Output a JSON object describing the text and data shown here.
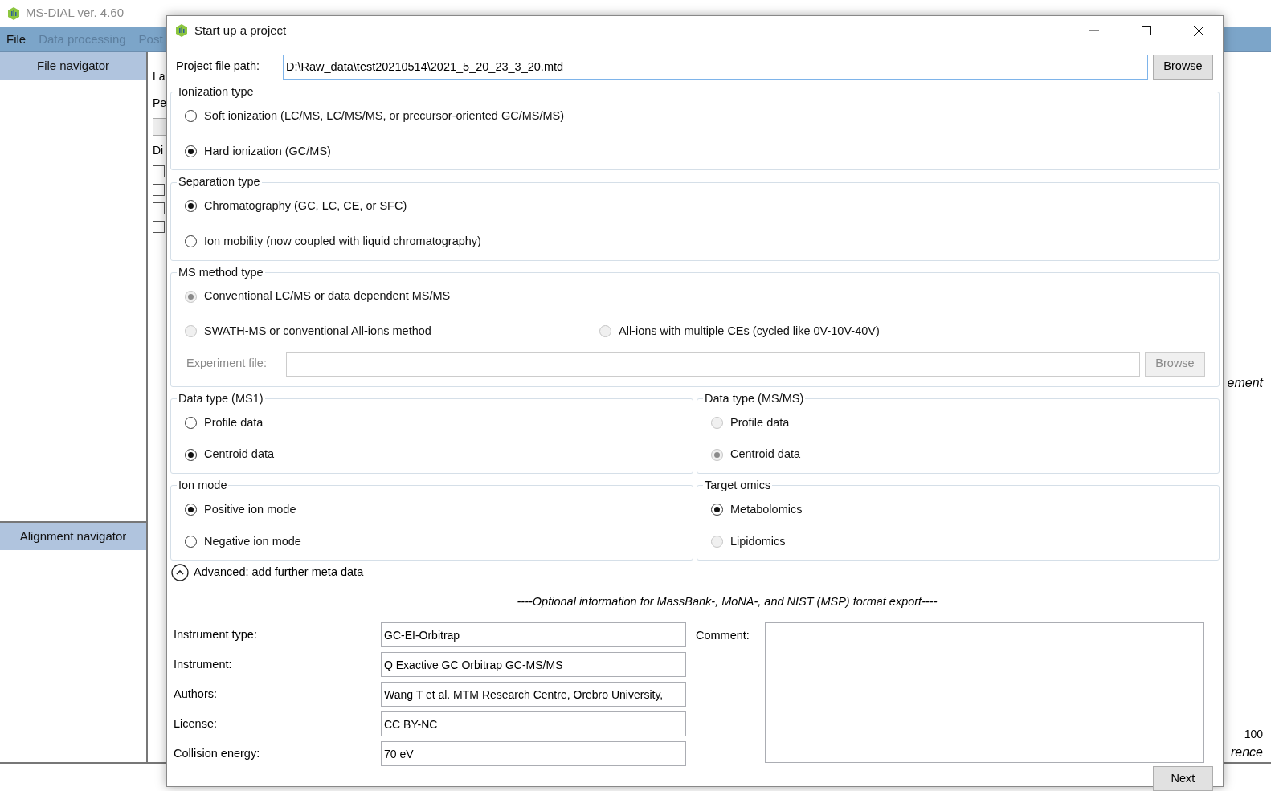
{
  "app": {
    "title": "MS-DIAL ver. 4.60",
    "menu": [
      {
        "label": "File",
        "disabled": false
      },
      {
        "label": "Data processing",
        "disabled": true
      },
      {
        "label": "Post",
        "disabled": true
      }
    ],
    "file_navigator": "File navigator",
    "alignment_navigator": "Alignment navigator",
    "panel_labels": [
      "La",
      "Pe",
      "Di"
    ],
    "checkboxes": [
      {
        "checked": false
      },
      {
        "checked": false
      },
      {
        "checked": false
      },
      {
        "checked": false
      }
    ],
    "right_labels": [
      "ement",
      "100",
      "rence"
    ]
  },
  "dialog": {
    "title": "Start up a project",
    "project_file_path": {
      "label": "Project file path:",
      "value": "D:\\Raw_data\\test20210514\\2021_5_20_23_3_20.mtd",
      "button": "Browse"
    },
    "groups": [
      {
        "title": "Ionization type",
        "rows": [
          [
            {
              "label": "Soft ionization (LC/MS, LC/MS/MS, or precursor-oriented GC/MS/MS)",
              "selected": false,
              "disabled": false
            }
          ],
          [
            {
              "label": "Hard ionization (GC/MS)",
              "selected": true,
              "disabled": false
            }
          ]
        ]
      },
      {
        "title": "Separation type",
        "rows": [
          [
            {
              "label": "Chromatography (GC, LC, CE, or SFC)",
              "selected": true,
              "disabled": false
            }
          ],
          [
            {
              "label": "Ion mobility (now coupled with liquid chromatography)",
              "selected": false,
              "disabled": false
            }
          ]
        ]
      },
      {
        "title": "MS method type",
        "rows": [
          [
            {
              "label": "Conventional LC/MS or data dependent MS/MS",
              "selected": true,
              "disabled": true
            }
          ],
          [
            {
              "label": "SWATH-MS or conventional All-ions method",
              "selected": false,
              "disabled": true
            },
            {
              "label": "All-ions with multiple CEs (cycled like 0V-10V-40V)",
              "selected": false,
              "disabled": true
            }
          ]
        ],
        "experiment_file": {
          "label": "Experiment file:",
          "button": "Browse",
          "disabled": true
        }
      }
    ],
    "paired_groups": [
      [
        {
          "title": "Data type (MS1)",
          "options": [
            {
              "label": "Profile data",
              "selected": false,
              "disabled": false
            },
            {
              "label": "Centroid data",
              "selected": true,
              "disabled": false
            }
          ]
        },
        {
          "title": "Data type (MS/MS)",
          "options": [
            {
              "label": "Profile data",
              "selected": false,
              "disabled": true
            },
            {
              "label": "Centroid data",
              "selected": true,
              "disabled": true
            }
          ]
        }
      ],
      [
        {
          "title": "Ion mode",
          "options": [
            {
              "label": "Positive ion mode",
              "selected": true,
              "disabled": false
            },
            {
              "label": "Negative ion mode",
              "selected": false,
              "disabled": false
            }
          ]
        },
        {
          "title": "Target omics",
          "options": [
            {
              "label": "Metabolomics",
              "selected": true,
              "disabled": false
            },
            {
              "label": "Lipidomics",
              "selected": false,
              "disabled": true
            }
          ]
        }
      ]
    ],
    "advanced": {
      "label": "Advanced: add further meta data",
      "expanded": true
    },
    "meta": {
      "heading": "----Optional information for MassBank-, MoNA-, and NIST (MSP) format export----",
      "fields": [
        {
          "label": "Instrument type:",
          "value": "GC-EI-Orbitrap"
        },
        {
          "label": "Instrument:",
          "value": "Q Exactive GC Orbitrap GC-MS/MS"
        },
        {
          "label": "Authors:",
          "value": "Wang T et al. MTM Research Centre, Orebro University,"
        },
        {
          "label": "License:",
          "value": "CC BY-NC"
        },
        {
          "label": "Collision energy:",
          "value": "70 eV"
        }
      ],
      "comment": {
        "label": "Comment:"
      }
    },
    "next_button": "Next"
  }
}
